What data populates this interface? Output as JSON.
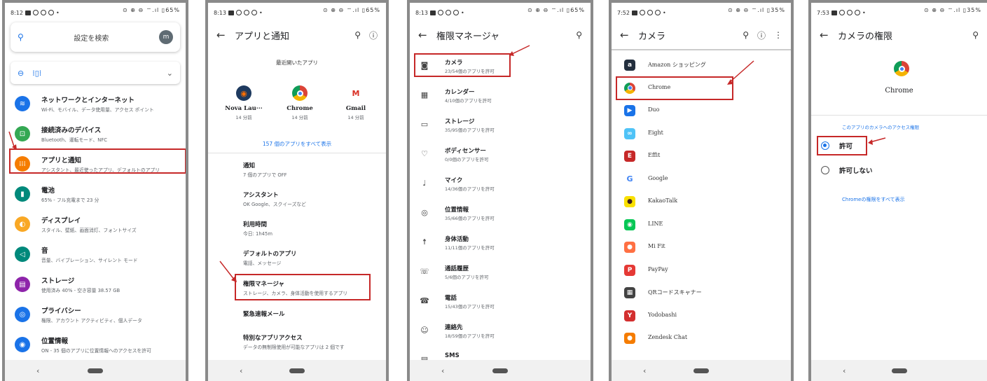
{
  "colors": {
    "accent": "#1a73e8",
    "highlight": "#c62828"
  },
  "panel1": {
    "status": {
      "time": "8:12",
      "right": "⊙ ⊕ ⊖ ⌔.ıl ▯65%"
    },
    "search_placeholder": "設定を検索",
    "avatar_letter": "m",
    "items": [
      {
        "icon": "wifi-icon",
        "color": "#1a73e8",
        "title": "ネットワークとインターネット",
        "sub": "Wi-Fi、モバイル、データ使用量、アクセス ポイント"
      },
      {
        "icon": "devices-icon",
        "color": "#34a853",
        "title": "接続済みのデバイス",
        "sub": "Bluetooth、運転モード、NFC"
      },
      {
        "icon": "apps-icon",
        "color": "#f57c00",
        "title": "アプリと通知",
        "sub": "アシスタント、最近使ったアプリ、デフォルトのアプリ"
      },
      {
        "icon": "battery-icon",
        "color": "#00897b",
        "title": "電池",
        "sub": "65% - フル充電まで 23 分"
      },
      {
        "icon": "display-icon",
        "color": "#f9a825",
        "title": "ディスプレイ",
        "sub": "スタイル、壁紙、画面消灯、フォントサイズ"
      },
      {
        "icon": "sound-icon",
        "color": "#00897b",
        "title": "音",
        "sub": "音量、バイブレーション、サイレント モード"
      },
      {
        "icon": "storage-icon",
        "color": "#8e24aa",
        "title": "ストレージ",
        "sub": "使用済み 40% - 空き容量 38.57 GB"
      },
      {
        "icon": "privacy-icon",
        "color": "#1a73e8",
        "title": "プライバシー",
        "sub": "権限、アカウント アクティビティ、個人データ"
      },
      {
        "icon": "location-icon",
        "color": "#1a73e8",
        "title": "位置情報",
        "sub": "ON - 35 個のアプリに位置情報へのアクセスを許可"
      }
    ]
  },
  "panel2": {
    "status": {
      "time": "8:13",
      "right": "⊙ ⊕ ⊖ ⌔.ıl ▯65%"
    },
    "title": "アプリと通知",
    "recent_header": "最近開いたアプリ",
    "recent_apps": [
      {
        "name": "Nova Lau···",
        "time": "14 分前",
        "icon": "nova-launcher-icon"
      },
      {
        "name": "Chrome",
        "time": "14 分前",
        "icon": "chrome-icon"
      },
      {
        "name": "Gmail",
        "time": "14 分前",
        "icon": "gmail-icon"
      }
    ],
    "see_all": "157 個のアプリをすべて表示",
    "items": [
      {
        "title": "通知",
        "sub": "7 個のアプリで OFF"
      },
      {
        "title": "アシスタント",
        "sub": "OK Google、スクイーズなど"
      },
      {
        "title": "利用時間",
        "sub": "今日: 1h45m"
      },
      {
        "title": "デフォルトのアプリ",
        "sub": "電話、メッセージ"
      },
      {
        "title": "権限マネージャ",
        "sub": "ストレージ、カメラ、身体活動を使用するアプリ"
      },
      {
        "title": "緊急速報メール",
        "sub": ""
      },
      {
        "title": "特別なアプリアクセス",
        "sub": "データの無制限使用が可能なアプリは 2 個です"
      }
    ]
  },
  "panel3": {
    "status": {
      "time": "8:13",
      "right": "⊙ ⊕ ⊖ ⌔.ıl ▯65%"
    },
    "title": "権限マネージャ",
    "items": [
      {
        "icon": "camera-icon",
        "glyph": "◙",
        "title": "カメラ",
        "sub": "23/54個のアプリを許可"
      },
      {
        "icon": "calendar-icon",
        "glyph": "▦",
        "title": "カレンダー",
        "sub": "4/10個のアプリを許可"
      },
      {
        "icon": "folder-icon",
        "glyph": "▭",
        "title": "ストレージ",
        "sub": "35/95個のアプリを許可"
      },
      {
        "icon": "heart-icon",
        "glyph": "♡",
        "title": "ボディセンサー",
        "sub": "0/0個のアプリを許可"
      },
      {
        "icon": "mic-icon",
        "glyph": "♩",
        "title": "マイク",
        "sub": "14/36個のアプリを許可"
      },
      {
        "icon": "location-icon",
        "glyph": "◎",
        "title": "位置情報",
        "sub": "35/66個のアプリを許可"
      },
      {
        "icon": "activity-icon",
        "glyph": "☨",
        "title": "身体活動",
        "sub": "11/11個のアプリを許可"
      },
      {
        "icon": "call-log-icon",
        "glyph": "☏",
        "title": "通話履歴",
        "sub": "5/6個のアプリを許可"
      },
      {
        "icon": "phone-icon",
        "glyph": "☎",
        "title": "電話",
        "sub": "15/43個のアプリを許可"
      },
      {
        "icon": "contacts-icon",
        "glyph": "☺",
        "title": "連絡先",
        "sub": "18/59個のアプリを許可"
      },
      {
        "icon": "sms-icon",
        "glyph": "▤",
        "title": "SMS",
        "sub": ""
      }
    ]
  },
  "panel4": {
    "status": {
      "time": "7:52",
      "right": "⊙ ⊕ ⊖ ⌔.ıl ▯35%"
    },
    "title": "カメラ",
    "apps": [
      {
        "name": "Amazon ショッピング",
        "icon": "amazon-icon",
        "color": "#232f3e",
        "glyph": "a"
      },
      {
        "name": "Chrome",
        "icon": "chrome-icon",
        "color": "#ffffff",
        "glyph": ""
      },
      {
        "name": "Duo",
        "icon": "duo-icon",
        "color": "#1a73e8",
        "glyph": "▶"
      },
      {
        "name": "Eight",
        "icon": "eight-icon",
        "color": "#4fc3f7",
        "glyph": "∞"
      },
      {
        "name": "Effit",
        "icon": "effit-icon",
        "color": "#c62828",
        "glyph": "E"
      },
      {
        "name": "Google",
        "icon": "google-icon",
        "color": "#ffffff",
        "glyph": "G"
      },
      {
        "name": "KakaoTalk",
        "icon": "kakaotalk-icon",
        "color": "#f9e000",
        "glyph": "●"
      },
      {
        "name": "LINE",
        "icon": "line-icon",
        "color": "#06c755",
        "glyph": "◉"
      },
      {
        "name": "Mi Fit",
        "icon": "mifit-icon",
        "color": "#ff7043",
        "glyph": "●"
      },
      {
        "name": "PayPay",
        "icon": "paypay-icon",
        "color": "#e53935",
        "glyph": "P"
      },
      {
        "name": "QRコードスキャナー",
        "icon": "qr-icon",
        "color": "#424242",
        "glyph": "▦"
      },
      {
        "name": "Yodobashi",
        "icon": "yodobashi-icon",
        "color": "#d32f2f",
        "glyph": "Y"
      },
      {
        "name": "Zendesk Chat",
        "icon": "zendesk-icon",
        "color": "#f57c00",
        "glyph": "●"
      }
    ]
  },
  "panel5": {
    "status": {
      "time": "7:53",
      "right": "⊙ ⊕ ⊖ ⌔.ıl ▯35%"
    },
    "title": "カメラの権限",
    "app_name": "Chrome",
    "section_label": "このアプリのカメラへのアクセス権限",
    "options": [
      {
        "label": "許可",
        "selected": true
      },
      {
        "label": "許可しない",
        "selected": false
      }
    ],
    "link": "Chromeの権限をすべて表示"
  }
}
